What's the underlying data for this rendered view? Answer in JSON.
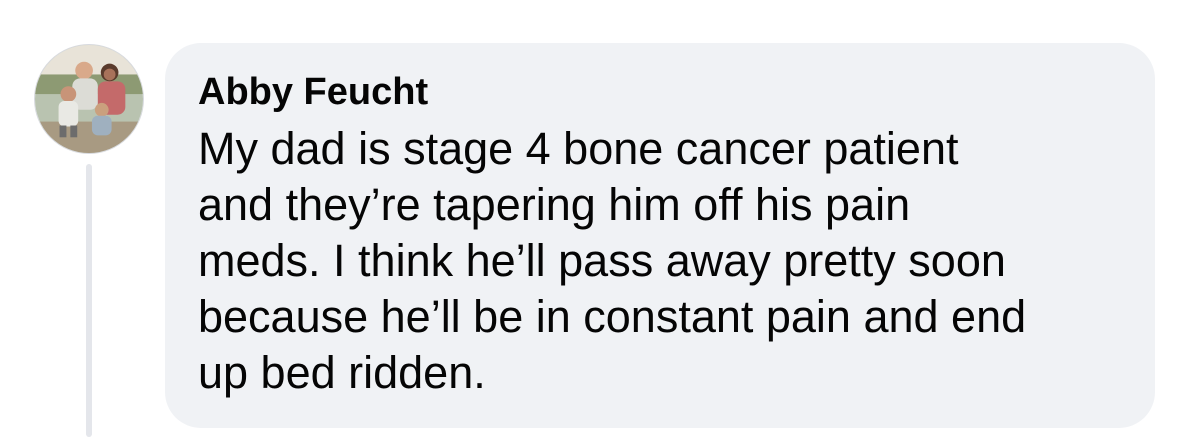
{
  "comment": {
    "author": "Abby Feucht",
    "avatar_icon": "family-photo-avatar",
    "text_lines": [
      "My dad is stage 4 bone cancer patient",
      "and they’re tapering him off his pain",
      "meds. I think he’ll pass away pretty soon",
      "because he’ll be in constant pain and end",
      "up bed ridden."
    ]
  },
  "colors": {
    "bubble_background": "#f0f2f5",
    "text": "#050505",
    "thread_line": "#e4e6eb",
    "page_background": "#ffffff"
  }
}
